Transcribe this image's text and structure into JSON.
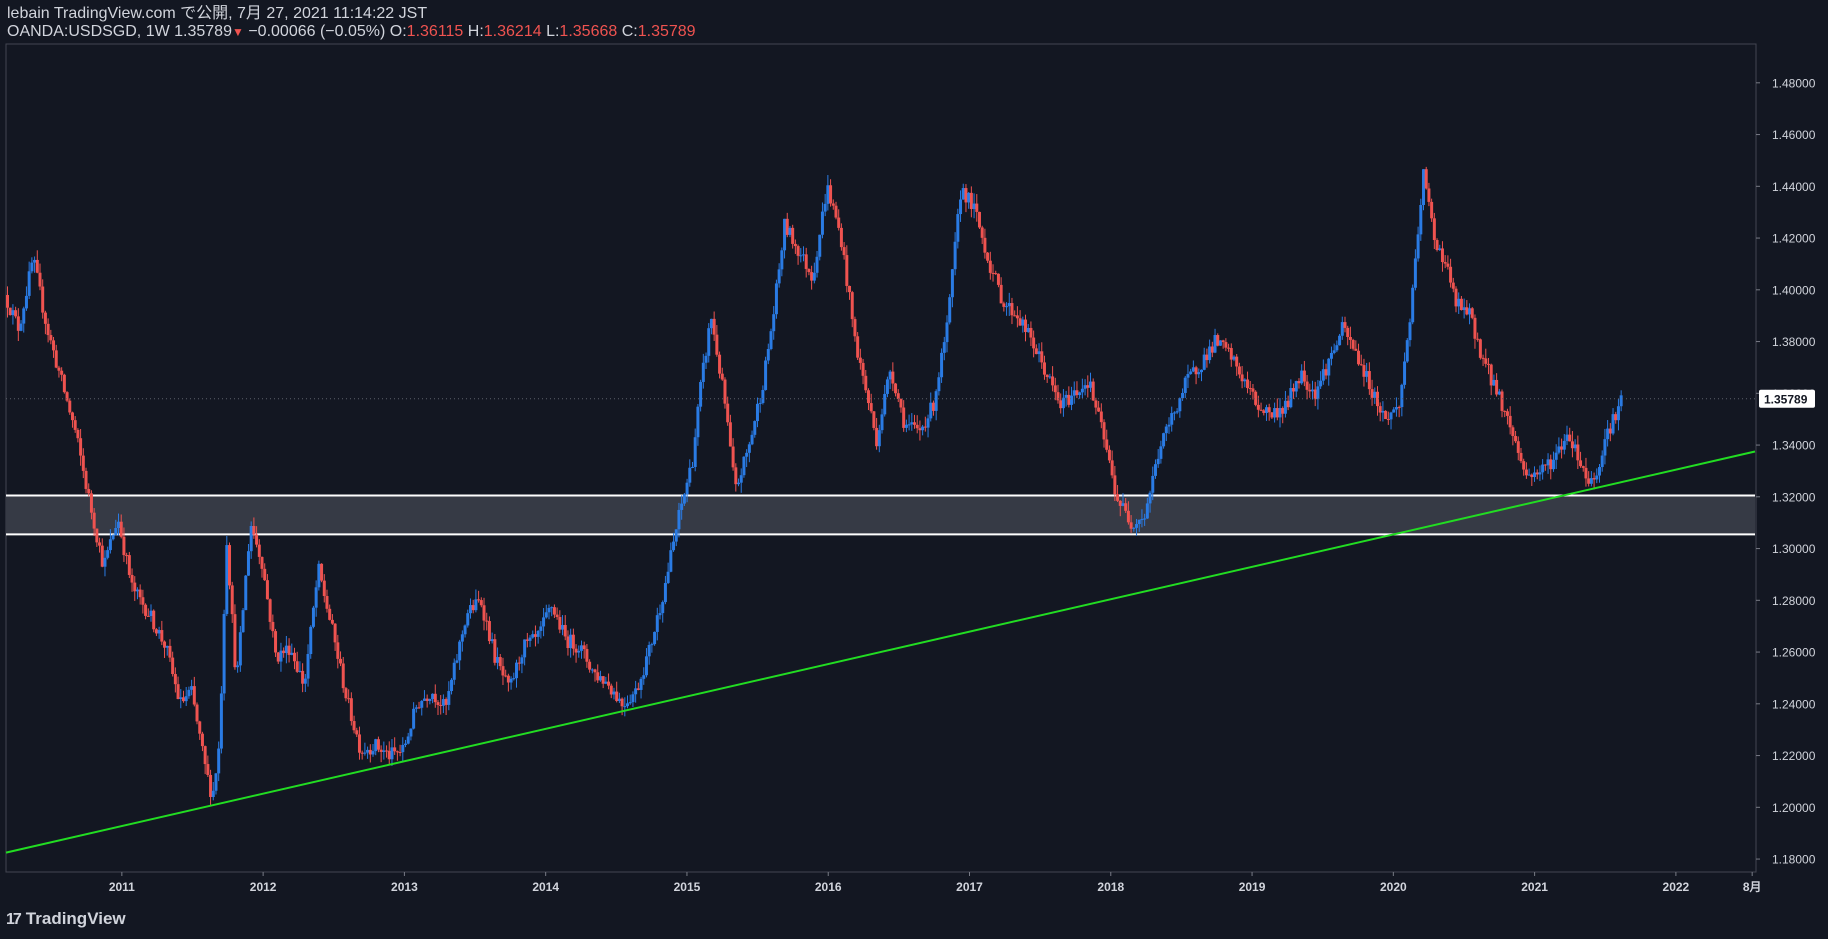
{
  "header": {
    "line1": "lebain TradingView.com で公開, 7月 27, 2021 11:14:22 JST",
    "symbol": "OANDA:USDSGD, 1W",
    "last": "1.35789",
    "change": "−0.00066 (−0.05%)",
    "open_label": "O:",
    "open": "1.36115",
    "high_label": "H:",
    "high": "1.36214",
    "low_label": "L:",
    "low": "1.35668",
    "close_label": "C:",
    "close": "1.35789"
  },
  "footer": {
    "brand": "TradingView"
  },
  "colors": {
    "background": "#131722",
    "up": "#2a7be4",
    "down": "#ef5350",
    "trendline": "#22dd22",
    "zone_border": "#ffffff",
    "zone_fill": "#363a45",
    "axis_text": "#d1d4dc"
  },
  "chart_data": {
    "type": "candlestick",
    "timeframe": "1W",
    "symbol": "OANDA:USDSGD",
    "ylim": [
      1.175,
      1.495
    ],
    "y_ticks": [
      "1.48000",
      "1.46000",
      "1.44000",
      "1.42000",
      "1.40000",
      "1.38000",
      "1.36000",
      "1.34000",
      "1.32000",
      "1.30000",
      "1.28000",
      "1.26000",
      "1.24000",
      "1.22000",
      "1.20000",
      "1.18000"
    ],
    "x_ticks": [
      "2011",
      "2012",
      "2013",
      "2014",
      "2015",
      "2016",
      "2017",
      "2018",
      "2019",
      "2020",
      "2021",
      "2022",
      "8月"
    ],
    "x_range": [
      2010.18,
      2022.56
    ],
    "last_price_label": "1.35789",
    "price_path": [
      [
        2010.18,
        1.398
      ],
      [
        2010.28,
        1.385
      ],
      [
        2010.38,
        1.412
      ],
      [
        2010.48,
        1.385
      ],
      [
        2010.58,
        1.365
      ],
      [
        2010.68,
        1.345
      ],
      [
        2010.78,
        1.318
      ],
      [
        2010.88,
        1.293
      ],
      [
        2010.98,
        1.312
      ],
      [
        2011.08,
        1.285
      ],
      [
        2011.2,
        1.275
      ],
      [
        2011.32,
        1.262
      ],
      [
        2011.42,
        1.24
      ],
      [
        2011.5,
        1.245
      ],
      [
        2011.6,
        1.215
      ],
      [
        2011.65,
        1.204
      ],
      [
        2011.7,
        1.225
      ],
      [
        2011.75,
        1.305
      ],
      [
        2011.82,
        1.248
      ],
      [
        2011.92,
        1.31
      ],
      [
        2012.0,
        1.295
      ],
      [
        2012.1,
        1.258
      ],
      [
        2012.2,
        1.262
      ],
      [
        2012.3,
        1.247
      ],
      [
        2012.4,
        1.292
      ],
      [
        2012.5,
        1.268
      ],
      [
        2012.6,
        1.242
      ],
      [
        2012.7,
        1.222
      ],
      [
        2012.8,
        1.224
      ],
      [
        2012.9,
        1.22
      ],
      [
        2013.0,
        1.222
      ],
      [
        2013.1,
        1.24
      ],
      [
        2013.2,
        1.245
      ],
      [
        2013.3,
        1.238
      ],
      [
        2013.45,
        1.275
      ],
      [
        2013.55,
        1.28
      ],
      [
        2013.65,
        1.258
      ],
      [
        2013.75,
        1.245
      ],
      [
        2013.85,
        1.262
      ],
      [
        2013.95,
        1.265
      ],
      [
        2014.05,
        1.278
      ],
      [
        2014.15,
        1.265
      ],
      [
        2014.25,
        1.262
      ],
      [
        2014.35,
        1.252
      ],
      [
        2014.45,
        1.248
      ],
      [
        2014.55,
        1.24
      ],
      [
        2014.65,
        1.245
      ],
      [
        2014.75,
        1.262
      ],
      [
        2014.85,
        1.285
      ],
      [
        2014.95,
        1.312
      ],
      [
        2015.05,
        1.335
      ],
      [
        2015.1,
        1.36
      ],
      [
        2015.18,
        1.39
      ],
      [
        2015.28,
        1.355
      ],
      [
        2015.35,
        1.322
      ],
      [
        2015.45,
        1.34
      ],
      [
        2015.55,
        1.365
      ],
      [
        2015.62,
        1.39
      ],
      [
        2015.7,
        1.425
      ],
      [
        2015.8,
        1.415
      ],
      [
        2015.9,
        1.405
      ],
      [
        2016.0,
        1.44
      ],
      [
        2016.1,
        1.42
      ],
      [
        2016.2,
        1.38
      ],
      [
        2016.3,
        1.355
      ],
      [
        2016.35,
        1.342
      ],
      [
        2016.45,
        1.37
      ],
      [
        2016.55,
        1.348
      ],
      [
        2016.65,
        1.345
      ],
      [
        2016.75,
        1.355
      ],
      [
        2016.85,
        1.385
      ],
      [
        2016.95,
        1.44
      ],
      [
        2017.05,
        1.43
      ],
      [
        2017.15,
        1.41
      ],
      [
        2017.25,
        1.395
      ],
      [
        2017.35,
        1.39
      ],
      [
        2017.45,
        1.38
      ],
      [
        2017.55,
        1.368
      ],
      [
        2017.65,
        1.355
      ],
      [
        2017.75,
        1.36
      ],
      [
        2017.85,
        1.365
      ],
      [
        2017.95,
        1.345
      ],
      [
        2018.05,
        1.32
      ],
      [
        2018.15,
        1.31
      ],
      [
        2018.25,
        1.313
      ],
      [
        2018.35,
        1.338
      ],
      [
        2018.45,
        1.352
      ],
      [
        2018.55,
        1.365
      ],
      [
        2018.65,
        1.372
      ],
      [
        2018.75,
        1.38
      ],
      [
        2018.85,
        1.375
      ],
      [
        2018.95,
        1.365
      ],
      [
        2019.05,
        1.355
      ],
      [
        2019.15,
        1.352
      ],
      [
        2019.25,
        1.355
      ],
      [
        2019.35,
        1.368
      ],
      [
        2019.45,
        1.36
      ],
      [
        2019.55,
        1.372
      ],
      [
        2019.65,
        1.385
      ],
      [
        2019.75,
        1.375
      ],
      [
        2019.85,
        1.362
      ],
      [
        2019.95,
        1.35
      ],
      [
        2020.05,
        1.355
      ],
      [
        2020.15,
        1.4
      ],
      [
        2020.22,
        1.445
      ],
      [
        2020.3,
        1.42
      ],
      [
        2020.38,
        1.41
      ],
      [
        2020.45,
        1.395
      ],
      [
        2020.55,
        1.39
      ],
      [
        2020.65,
        1.372
      ],
      [
        2020.75,
        1.36
      ],
      [
        2020.85,
        1.345
      ],
      [
        2020.95,
        1.328
      ],
      [
        2021.05,
        1.33
      ],
      [
        2021.15,
        1.335
      ],
      [
        2021.25,
        1.345
      ],
      [
        2021.32,
        1.335
      ],
      [
        2021.4,
        1.325
      ],
      [
        2021.45,
        1.33
      ],
      [
        2021.52,
        1.345
      ],
      [
        2021.57,
        1.35
      ],
      [
        2021.62,
        1.358
      ]
    ],
    "series": [
      {
        "name": "",
        "type": "trendline",
        "points": [
          [
            2010.18,
            1.1825
          ],
          [
            2022.56,
            1.3375
          ]
        ]
      }
    ],
    "zone": {
      "upper": 1.3205,
      "lower": 1.3055
    }
  }
}
